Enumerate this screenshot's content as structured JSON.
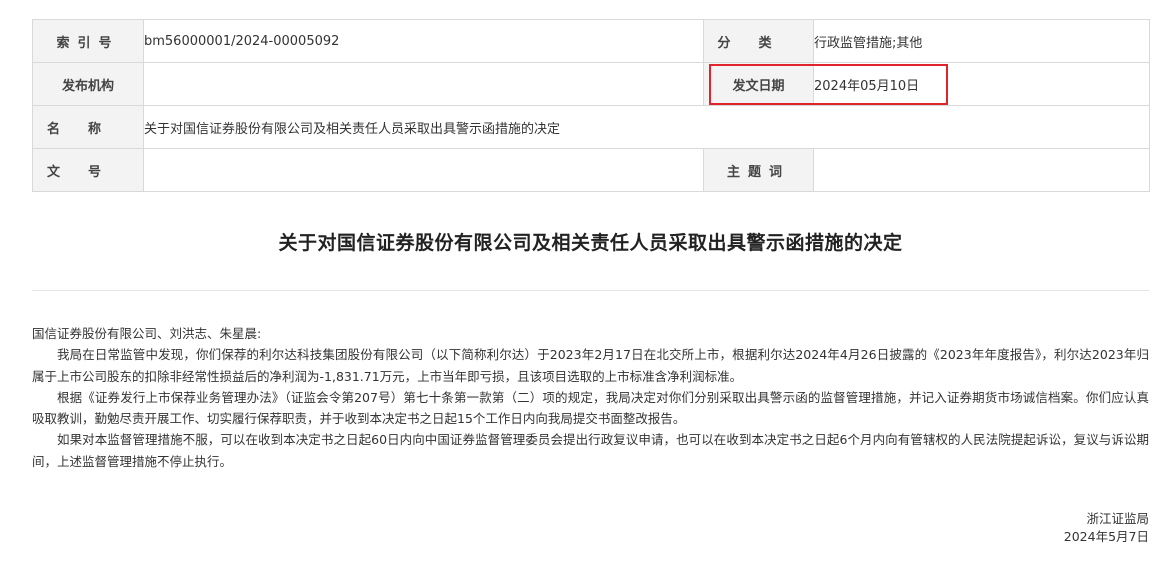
{
  "meta_table": {
    "index_label": "索引号",
    "index_value": "bm56000001/2024-00005092",
    "category_label": "分类",
    "category_value": "行政监管措施;其他",
    "issuer_label": "发布机构",
    "issuer_value": "",
    "date_label": "发文日期",
    "date_value": "2024年05月10日",
    "name_label": "名称",
    "name_value": "关于对国信证券股份有限公司及相关责任人员采取出具警示函措施的决定",
    "doc_no_label": "文号",
    "doc_no_value": "",
    "keywords_label": "主题词",
    "keywords_value": "",
    "highlight_color": "#e0242c"
  },
  "document": {
    "title": "关于对国信证券股份有限公司及相关责任人员采取出具警示函措施的决定",
    "addressee": "国信证券股份有限公司、刘洪志、朱星晨:",
    "paragraphs": [
      "我局在日常监管中发现，你们保荐的利尔达科技集团股份有限公司（以下简称利尔达）于2023年2月17日在北交所上市，根据利尔达2024年4月26日披露的《2023年年度报告》，利尔达2023年归属于上市公司股东的扣除非经常性损益后的净利润为-1,831.71万元，上市当年即亏损，且该项目选取的上市标准含净利润标准。",
      "根据《证券发行上市保荐业务管理办法》（证监会令第207号）第七十条第一款第（二）项的规定，我局决定对你们分别采取出具警示函的监督管理措施，并记入证券期货市场诚信档案。你们应认真吸取教训，勤勉尽责开展工作、切实履行保荐职责，并于收到本决定书之日起15个工作日内向我局提交书面整改报告。",
      "如果对本监督管理措施不服，可以在收到本决定书之日起60日内向中国证券监督管理委员会提出行政复议申请，也可以在收到本决定书之日起6个月内向有管辖权的人民法院提起诉讼，复议与诉讼期间，上述监督管理措施不停止执行。"
    ],
    "signature_org": "浙江证监局",
    "signature_date": "2024年5月7日"
  }
}
